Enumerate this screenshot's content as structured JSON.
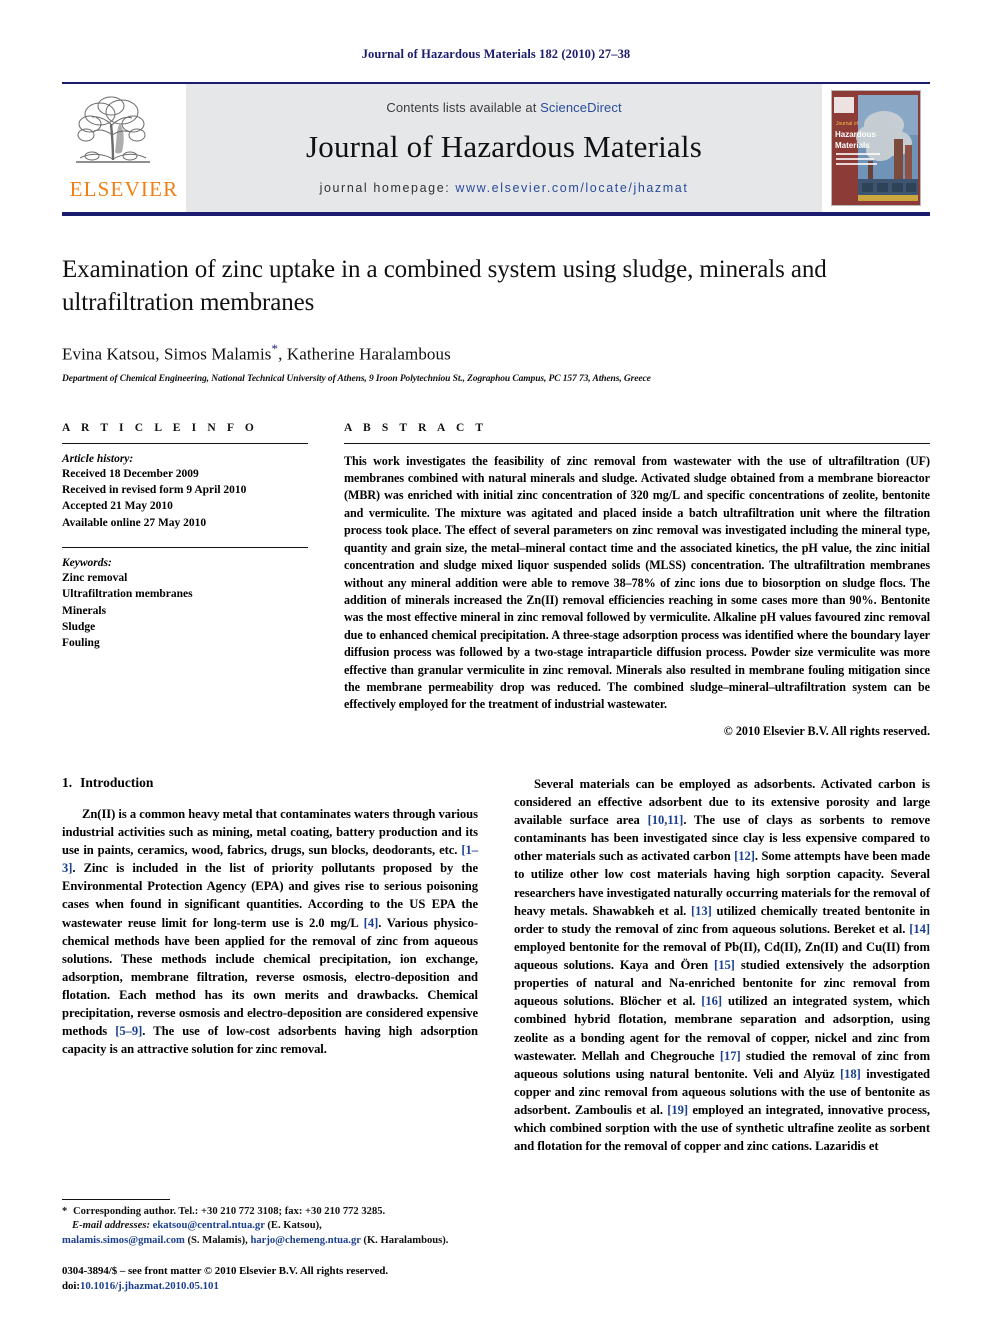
{
  "running_head": "Journal of Hazardous Materials 182 (2010) 27–38",
  "masthead": {
    "contents_prefix": "Contents lists available at ",
    "sciencedirect": "ScienceDirect",
    "journal_title": "Journal of Hazardous Materials",
    "homepage_label": "journal homepage:",
    "homepage_url": "www.elsevier.com/locate/jhazmat",
    "publisher_wordmark": "ELSEVIER",
    "cover_title_line1": "Journal of",
    "cover_title_line2": "Hazardous",
    "cover_title_line3": "Materials",
    "accent_blue": "#1b1b6f",
    "accent_orange": "#f07f13",
    "panel_grey": "#e6e7e8"
  },
  "article": {
    "title": "Examination of zinc uptake in a combined system using sludge, minerals and ultrafiltration membranes",
    "authors": "Evina Katsou, Simos Malamis",
    "authors_tail": ", Katherine Haralambous",
    "corresponding_marker": "*",
    "affiliation": "Department of Chemical Engineering, National Technical University of Athens, 9 Iroon Polytechniou St., Zographou Campus, PC 157 73, Athens, Greece"
  },
  "article_info": {
    "heading": "A R T I C L E   I N F O",
    "history_title": "Article history:",
    "history": [
      "Received 18 December 2009",
      "Received in revised form 9 April 2010",
      "Accepted 21 May 2010",
      "Available online 27 May 2010"
    ],
    "keywords_title": "Keywords:",
    "keywords": [
      "Zinc removal",
      "Ultrafiltration membranes",
      "Minerals",
      "Sludge",
      "Fouling"
    ]
  },
  "abstract": {
    "heading": "A B S T R A C T",
    "text": "This work investigates the feasibility of zinc removal from wastewater with the use of ultrafiltration (UF) membranes combined with natural minerals and sludge. Activated sludge obtained from a membrane bioreactor (MBR) was enriched with initial zinc concentration of 320 mg/L and specific concentrations of zeolite, bentonite and vermiculite. The mixture was agitated and placed inside a batch ultrafiltration unit where the filtration process took place. The effect of several parameters on zinc removal was investigated including the mineral type, quantity and grain size, the metal–mineral contact time and the associated kinetics, the pH value, the zinc initial concentration and sludge mixed liquor suspended solids (MLSS) concentration. The ultrafiltration membranes without any mineral addition were able to remove 38–78% of zinc ions due to biosorption on sludge flocs. The addition of minerals increased the Zn(II) removal efficiencies reaching in some cases more than 90%. Bentonite was the most effective mineral in zinc removal followed by vermiculite. Alkaline pH values favoured zinc removal due to enhanced chemical precipitation. A three-stage adsorption process was identified where the boundary layer diffusion process was followed by a two-stage intraparticle diffusion process. Powder size vermiculite was more effective than granular vermiculite in zinc removal. Minerals also resulted in membrane fouling mitigation since the membrane permeability drop was reduced. The combined sludge–mineral–ultrafiltration system can be effectively employed for the treatment of industrial wastewater.",
    "copyright": "© 2010 Elsevier B.V. All rights reserved."
  },
  "introduction": {
    "number": "1.",
    "heading": "Introduction",
    "left_para_1_a": "Zn(II) is a common heavy metal that contaminates waters through various industrial activities such as mining, metal coating, battery production and its use in paints, ceramics, wood, fabrics, drugs, sun blocks, deodorants, etc. ",
    "left_ref_1": "[1–3]",
    "left_para_1_b": ". Zinc is included in the list of priority pollutants proposed by the Environmental Protection Agency (EPA) and gives rise to serious poisoning cases when found in significant quantities. According to the US EPA the wastewater reuse limit for long-term use is 2.0 mg/L ",
    "left_ref_2": "[4]",
    "left_para_1_c": ". Various physico-chemical methods have been applied for the removal of zinc from aqueous solutions. These methods include chemical precipitation, ion exchange, adsorption, membrane filtration, reverse osmosis, electro-deposition and flotation. Each method has its own merits and drawbacks. Chemical precipitation, reverse osmosis and electro-deposition are considered expensive methods ",
    "left_ref_3": "[5–9]",
    "left_para_1_d": ". The use of low-cost adsorbents having high adsorption capacity is an attractive solution for zinc removal.",
    "right_para_a": "Several materials can be employed as adsorbents. Activated carbon is considered an effective adsorbent due to its extensive porosity and large available surface area ",
    "right_ref_1": "[10,11]",
    "right_para_b": ". The use of clays as sorbents to remove contaminants has been investigated since clay is less expensive compared to other materials such as activated carbon ",
    "right_ref_2": "[12]",
    "right_para_c": ". Some attempts have been made to utilize other low cost materials having high sorption capacity. Several researchers have investigated naturally occurring materials for the removal of heavy metals. Shawabkeh et al. ",
    "right_ref_3": "[13]",
    "right_para_d": " utilized chemically treated bentonite in order to study the removal of zinc from aqueous solutions. Bereket et al. ",
    "right_ref_4": "[14]",
    "right_para_e": " employed bentonite for the removal of Pb(II), Cd(II), Zn(II) and Cu(II) from aqueous solutions. Kaya and Ören ",
    "right_ref_5": "[15]",
    "right_para_f": " studied extensively the adsorption properties of natural and Na-enriched bentonite for zinc removal from aqueous solutions. Blöcher et al. ",
    "right_ref_6": "[16]",
    "right_para_g": " utilized an integrated system, which combined hybrid flotation, membrane separation and adsorption, using zeolite as a bonding agent for the removal of copper, nickel and zinc from wastewater. Mellah and Chegrouche ",
    "right_ref_7": "[17]",
    "right_para_h": " studied the removal of zinc from aqueous solutions using natural bentonite. Veli and Alyüz ",
    "right_ref_8": "[18]",
    "right_para_i": " investigated copper and zinc removal from aqueous solutions with the use of bentonite as adsorbent. Zamboulis et al. ",
    "right_ref_9": "[19]",
    "right_para_j": " employed an integrated, innovative process, which combined sorption with the use of synthetic ultrafine zeolite as sorbent and flotation for the removal of copper and zinc cations. Lazaridis et"
  },
  "footnote": {
    "star": "*",
    "corresponding": " Corresponding author. Tel.: +30 210 772 3108; fax: +30 210 772 3285.",
    "email_label": "E-mail addresses:",
    "email_1": "ekatsou@central.ntua.gr",
    "email_1_name": " (E. Katsou),",
    "email_2": "malamis.simos@gmail.com",
    "email_2_name": " (S. Malamis),",
    "email_3": "harjo@chemeng.ntua.gr",
    "email_3_name": " (K. Haralambous)."
  },
  "footer": {
    "issn_line": "0304-3894/$ – see front matter © 2010 Elsevier B.V. All rights reserved.",
    "doi_label": "doi:",
    "doi_value": "10.1016/j.jhazmat.2010.05.101"
  }
}
